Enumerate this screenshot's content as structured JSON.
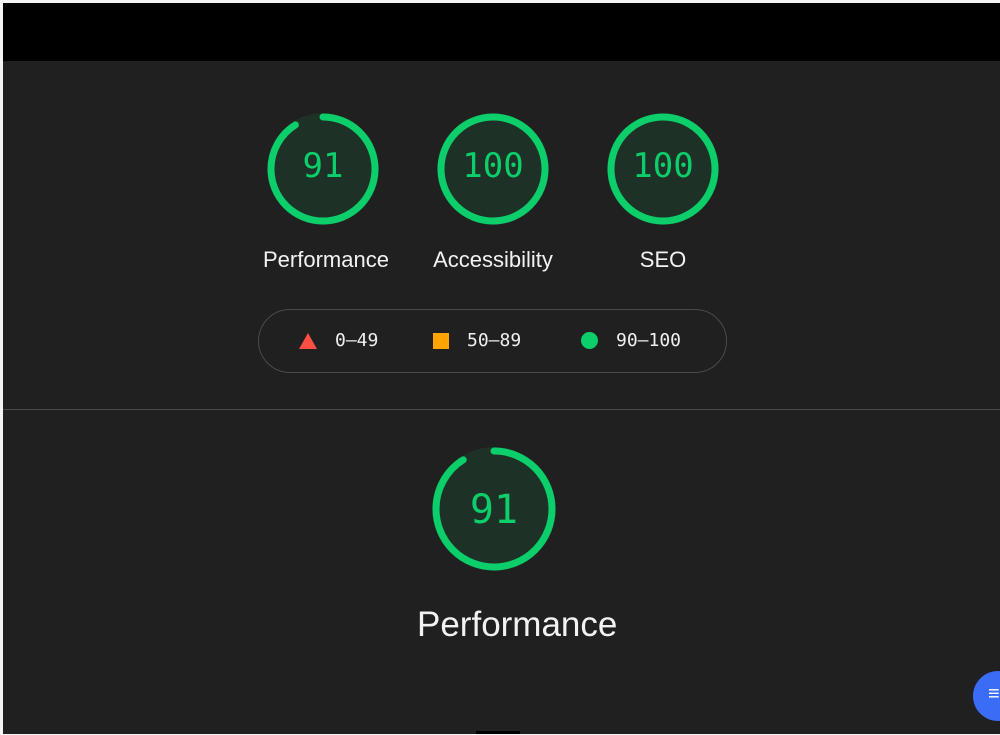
{
  "summary_gauges": [
    {
      "value": "91",
      "label": "Performance",
      "score": 91
    },
    {
      "value": "100",
      "label": "Accessibility",
      "score": 100
    },
    {
      "value": "100",
      "label": "SEO",
      "score": 100
    }
  ],
  "legend": {
    "fail": "0–49",
    "average": "50–89",
    "pass": "90–100"
  },
  "category": {
    "value": "91",
    "label": "Performance",
    "score": 91
  },
  "fab": {
    "icon": "menu-icon",
    "glyph": "≡"
  },
  "colors": {
    "pass": "#0cce6b",
    "average": "#ffa400",
    "fail": "#ff4e42",
    "background": "#202020",
    "fab": "#3b6cf6"
  }
}
